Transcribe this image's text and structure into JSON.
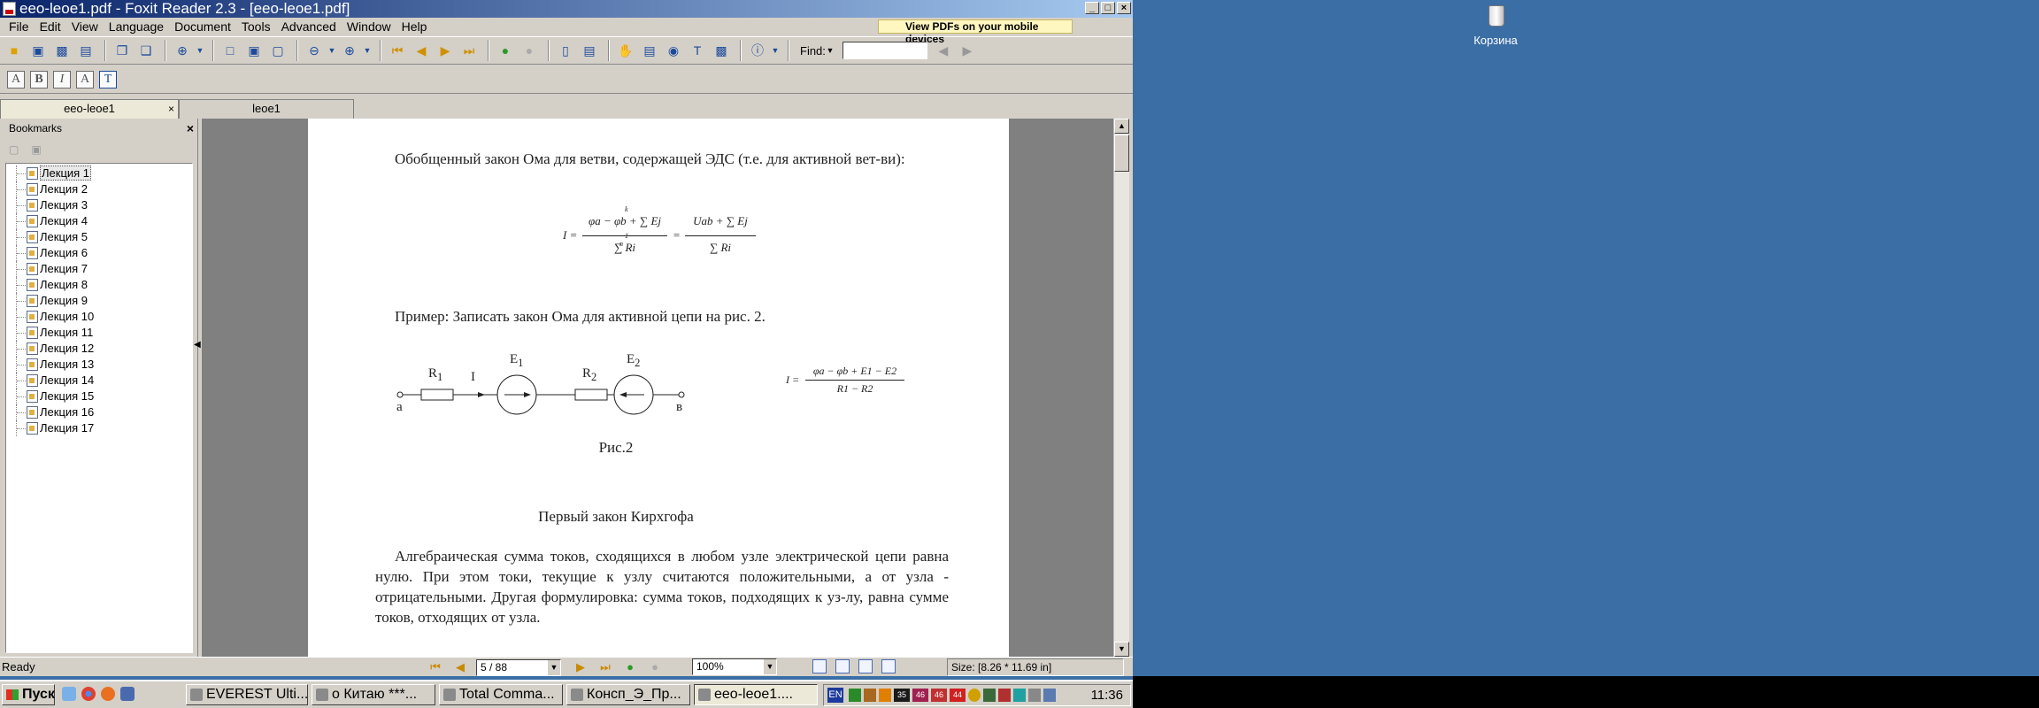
{
  "window": {
    "title": "eeo-leoe1.pdf - Foxit Reader 2.3 - [eeo-leoe1.pdf]",
    "min": "_",
    "max": "□",
    "close": "×"
  },
  "menu": [
    "File",
    "Edit",
    "View",
    "Language",
    "Document",
    "Tools",
    "Advanced",
    "Window",
    "Help"
  ],
  "promo": "View PDFs on your mobile devices",
  "toolbar": {
    "find_label": "Find:"
  },
  "tabs": [
    {
      "label": "eeo-leoe1",
      "close": "×"
    },
    {
      "label": "leoe1"
    }
  ],
  "bookmarks": {
    "title": "Bookmarks",
    "close": "×",
    "items": [
      "Лекция 1",
      "Лекция 2",
      "Лекция 3",
      "Лекция 4",
      "Лекция 5",
      "Лекция 6",
      "Лекция 7",
      "Лекция 8",
      "Лекция 9",
      "Лекция 10",
      "Лекция 11",
      "Лекция 12",
      "Лекция 13",
      "Лекция 14",
      "Лекция 15",
      "Лекция 16",
      "Лекция 17"
    ]
  },
  "document": {
    "para1": "Обобщенный закон Ома для ветви, содержащей ЭДС (т.е. для активной вет-ви):",
    "formula": {
      "I": "I =",
      "num1": "φa − φb + ∑ Ej",
      "num2": "Uab + ∑ Ej",
      "den": "∑ Ri",
      "eq": "=",
      "k": "k",
      "one": "1",
      "n": "n"
    },
    "para2": "Пример: Записать закон Ома для активной цепи на рис. 2.",
    "circuit": {
      "R1": "R",
      "R1sub": "1",
      "I": "I",
      "E1": "E",
      "E1sub": "1",
      "R2": "R",
      "R2sub": "2",
      "E2": "E",
      "E2sub": "2",
      "a": "a",
      "b": "в"
    },
    "formula2": {
      "I": "I =",
      "num": "φa − φb + E1 − E2",
      "den": "R1 − R2"
    },
    "caption": "Рис.2",
    "heading": "Первый закон Кирхгофа",
    "para3": "Алгебраическая сумма токов, сходящихся в любом узле электрической цепи равна нулю. При этом токи, текущие к узлу считаются положительными, а от узла - отрицательными. Другая формулировка: сумма токов, подходящих к уз-лу, равна сумме токов, отходящих от узла."
  },
  "status": {
    "ready": "Ready",
    "page": "5 / 88",
    "zoom": "100%",
    "size": "Size: [8.26 * 11.69 in]"
  },
  "taskbar": {
    "start": "Пуск",
    "buttons": [
      "EVEREST Ulti...",
      "о Китаю ***...",
      "Total Comma...",
      "Консп_Э_Пр...",
      "eeo-leoe1...."
    ],
    "lang": "EN",
    "tray_numbers": [
      "35",
      "46",
      "46",
      "44"
    ],
    "clock": "11:36"
  },
  "desktop": {
    "bin_label": "Корзина"
  },
  "colors": {
    "titlebar": "#0a246a",
    "desktop": "#3a6ea5",
    "chrome": "#d4d0c8"
  }
}
